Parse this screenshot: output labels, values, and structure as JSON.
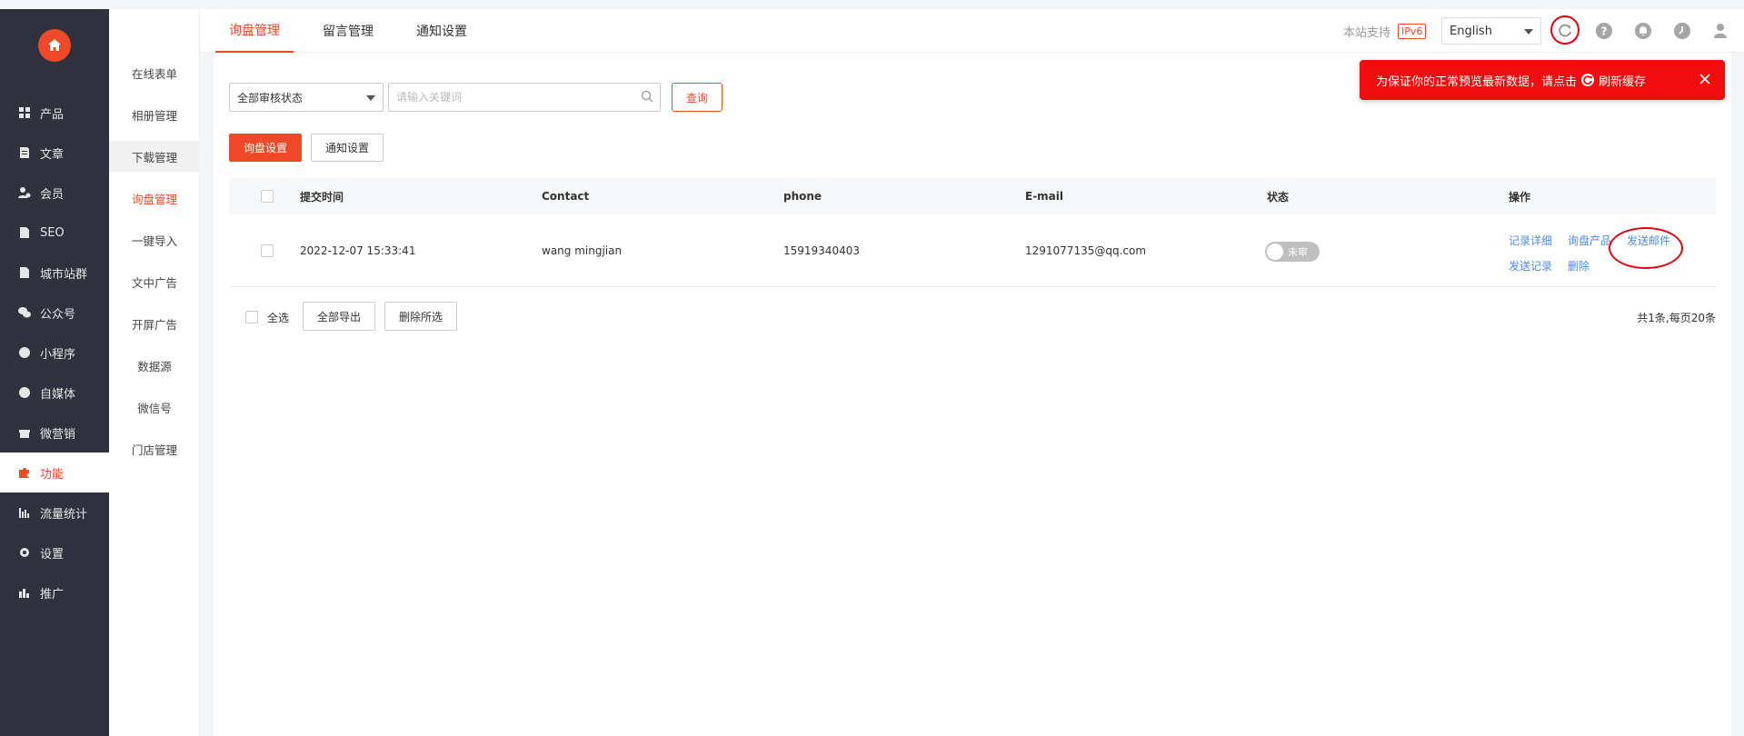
{
  "sidebar": {
    "items": [
      {
        "label": "产品",
        "icon": "grid-icon"
      },
      {
        "label": "文章",
        "icon": "document-icon"
      },
      {
        "label": "会员",
        "icon": "member-icon"
      },
      {
        "label": "SEO",
        "icon": "file-icon"
      },
      {
        "label": "城市站群",
        "icon": "file-icon"
      },
      {
        "label": "公众号",
        "icon": "wechat-icon"
      },
      {
        "label": "小程序",
        "icon": "miniprogram-icon"
      },
      {
        "label": "自媒体",
        "icon": "media-icon"
      },
      {
        "label": "微营销",
        "icon": "gift-icon"
      },
      {
        "label": "功能",
        "icon": "puzzle-icon"
      },
      {
        "label": "流量统计",
        "icon": "bar-chart-icon"
      },
      {
        "label": "设置",
        "icon": "gear-icon"
      },
      {
        "label": "推广",
        "icon": "promotion-icon"
      }
    ],
    "active_index": 9
  },
  "subnav": {
    "items": [
      "在线表单",
      "相册管理",
      "下载管理",
      "询盘管理",
      "一键导入",
      "文中广告",
      "开屏广告",
      "数据源",
      "微信号",
      "门店管理"
    ],
    "active_label": "询盘管理",
    "selected_label": "下载管理"
  },
  "topbar": {
    "tabs": [
      "询盘管理",
      "留言管理",
      "通知设置"
    ],
    "active_tab": "询盘管理",
    "site_support": "本站支持",
    "ipv6_badge": "IPv6",
    "language": "English"
  },
  "filters": {
    "status_select": "全部审核状态",
    "keyword_placeholder": "请输入关键词",
    "query_button": "查询"
  },
  "actions": {
    "inquiry_settings": "询盘设置",
    "notify_settings": "通知设置"
  },
  "table": {
    "headers": [
      "提交时间",
      "Contact",
      "phone",
      "E-mail",
      "状态",
      "操作"
    ],
    "rows": [
      {
        "time": "2022-12-07 15:33:41",
        "contact": "wang mingjian",
        "phone": "15919340403",
        "email": "1291077135@qq.com",
        "status": "未审",
        "status_on": false,
        "ops": [
          "记录详细",
          "询盘产品",
          "发送邮件",
          "发送记录",
          "删除"
        ]
      }
    ]
  },
  "footer": {
    "select_all": "全选",
    "export_all": "全部导出",
    "delete_selected": "删除所选",
    "total": "共1条,每页20条"
  },
  "toast": {
    "text_before": "为保证你的正常预览最新数据，请点击",
    "text_after": "刷新缓存"
  },
  "colors": {
    "accent": "#f0492a",
    "sidebar_bg": "#2f323d",
    "link": "#4b8be8",
    "toast_bg": "#f00d0d"
  }
}
